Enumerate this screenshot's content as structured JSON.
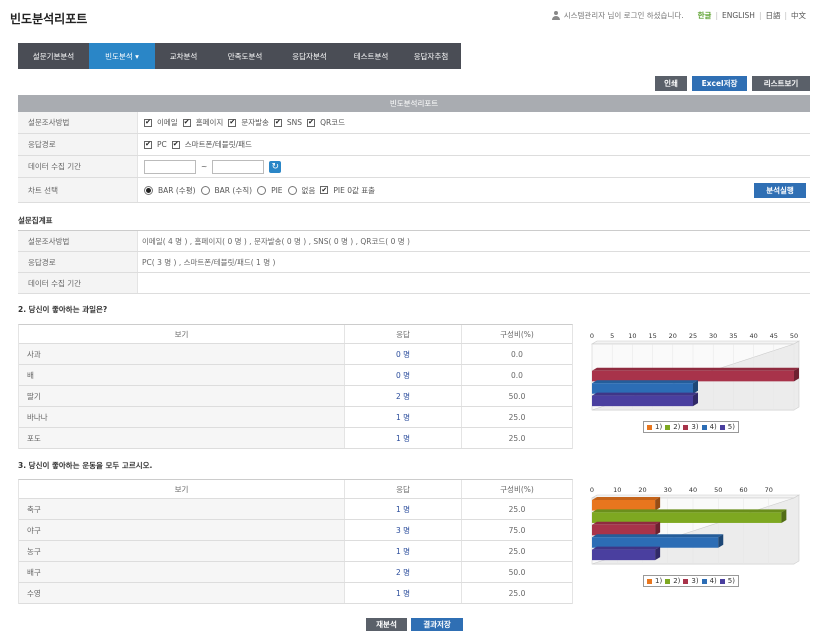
{
  "header": {
    "title": "빈도분석리포트",
    "login_msg": "시스템관리자 님이 로그인 하셨습니다.",
    "langs": [
      {
        "label": "한글",
        "active": true
      },
      {
        "label": "ENGLISH",
        "active": false
      },
      {
        "label": "日語",
        "active": false
      },
      {
        "label": "中文",
        "active": false
      }
    ]
  },
  "nav": {
    "items": [
      {
        "label": "설문기본분석",
        "active": false
      },
      {
        "label": "빈도분석 ▾",
        "active": true
      },
      {
        "label": "교차분석",
        "active": false
      },
      {
        "label": "만족도분석",
        "active": false
      },
      {
        "label": "응답자분석",
        "active": false
      },
      {
        "label": "테스트분석",
        "active": false
      },
      {
        "label": "응답자추첨",
        "active": false
      }
    ]
  },
  "actions": {
    "print": "인쇄",
    "excel": "Excel저장",
    "list": "리스트보기",
    "run": "분석실행",
    "reanalyze": "재분석",
    "save_result": "결과저장"
  },
  "report_form": {
    "title": "빈도분석리포트",
    "method": {
      "label": "설문조사방법",
      "options": [
        {
          "label": "이메일",
          "checked": true
        },
        {
          "label": "홈페이지",
          "checked": true
        },
        {
          "label": "문자발송",
          "checked": true
        },
        {
          "label": "SNS",
          "checked": true
        },
        {
          "label": "QR코드",
          "checked": true
        }
      ]
    },
    "route": {
      "label": "응답경로",
      "options": [
        {
          "label": "PC",
          "checked": true
        },
        {
          "label": "스마트폰/테블릿/패드",
          "checked": true
        }
      ]
    },
    "period": {
      "label": "데이터 수집 기간",
      "tilde": "~",
      "from": "",
      "to": ""
    },
    "chart_select": {
      "label": "차트 선택",
      "radios": [
        {
          "label": "BAR (수평)",
          "on": true
        },
        {
          "label": "BAR (수직)",
          "on": false
        },
        {
          "label": "PIE",
          "on": false
        },
        {
          "label": "없음",
          "on": false
        }
      ],
      "pie_zero": {
        "label": "PIE 0값 표출",
        "checked": true
      }
    }
  },
  "summary": {
    "title": "설문집계표",
    "rows": [
      {
        "label": "설문조사방법",
        "value": "이메일( 4 명 ) , 홈페이지( 0 명 ) , 문자발송( 0 명 ) , SNS( 0 명 ) , QR코드( 0 명 )"
      },
      {
        "label": "응답경로",
        "value": "PC( 3 명 ) , 스마트폰/테블릿/패드( 1 명 )"
      },
      {
        "label": "데이터 수집 기간",
        "value": ""
      }
    ]
  },
  "questions": [
    {
      "title": "2. 당신이 좋아하는 과일은?",
      "headers": [
        "보기",
        "응답",
        "구성비(%)"
      ],
      "rows": [
        {
          "label": "사과",
          "count": "0 명",
          "pct": "0.0"
        },
        {
          "label": "배",
          "count": "0 명",
          "pct": "0.0"
        },
        {
          "label": "딸기",
          "count": "2 명",
          "pct": "50.0"
        },
        {
          "label": "바나나",
          "count": "1 명",
          "pct": "25.0"
        },
        {
          "label": "포도",
          "count": "1 명",
          "pct": "25.0"
        }
      ]
    },
    {
      "title": "3. 당신이 좋아하는 운동을 모두 고르시오.",
      "headers": [
        "보기",
        "응답",
        "구성비(%)"
      ],
      "rows": [
        {
          "label": "축구",
          "count": "1 명",
          "pct": "25.0"
        },
        {
          "label": "야구",
          "count": "3 명",
          "pct": "75.0"
        },
        {
          "label": "농구",
          "count": "1 명",
          "pct": "25.0"
        },
        {
          "label": "배구",
          "count": "2 명",
          "pct": "50.0"
        },
        {
          "label": "수영",
          "count": "1 명",
          "pct": "25.0"
        }
      ]
    }
  ],
  "chart_data": [
    {
      "type": "bar",
      "orientation": "horizontal",
      "categories": [
        "1)",
        "2)",
        "3)",
        "4)",
        "5)"
      ],
      "values": [
        0,
        0,
        50,
        25,
        25
      ],
      "xlim": [
        0,
        50
      ],
      "ticks": [
        "0",
        "5",
        "10",
        "15",
        "20",
        "25",
        "30",
        "35",
        "40",
        "45",
        "50"
      ],
      "legend": [
        "1)",
        "2)",
        "3)",
        "4)",
        "5)"
      ],
      "colors": [
        "#e8761e",
        "#7ea821",
        "#a8334a",
        "#2c6db5",
        "#4a3f9f"
      ]
    },
    {
      "type": "bar",
      "orientation": "horizontal",
      "categories": [
        "1)",
        "2)",
        "3)",
        "4)",
        "5)"
      ],
      "values": [
        25,
        75,
        25,
        50,
        25
      ],
      "xlim": [
        0,
        80
      ],
      "ticks": [
        "0",
        "10",
        "20",
        "30",
        "40",
        "50",
        "60",
        "70"
      ],
      "legend": [
        "1)",
        "2)",
        "3)",
        "4)",
        "5)"
      ],
      "colors": [
        "#e8761e",
        "#7ea821",
        "#a8334a",
        "#2c6db5",
        "#4a3f9f"
      ]
    }
  ]
}
